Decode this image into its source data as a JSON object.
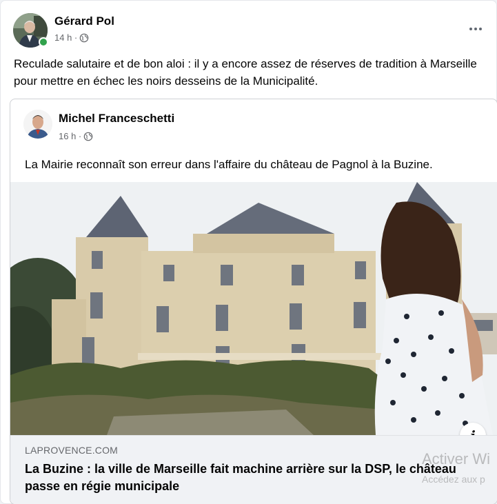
{
  "post": {
    "author_name": "Gérard Pol",
    "timestamp": "14 h ·",
    "text": "Reculade salutaire et de bon aloi : il y a encore assez de réserves de tradition à Marseille pour mettre en échec les noirs desseins de la Municipalité.",
    "more_icon": "more-options-icon",
    "audience_icon": "globe-icon"
  },
  "shared_post": {
    "author_name": "Michel Franceschetti",
    "timestamp": "16 h ·",
    "text": "La Mairie reconnaît son erreur dans l'affaire du château de Pagnol à la Buzine.",
    "audience_icon": "globe-icon"
  },
  "link_preview": {
    "domain": "LAPROVENCE.COM",
    "title": "La Buzine : la ville de Marseille fait machine arrière sur la DSP, le château passe en régie municipale",
    "info_label": "i"
  },
  "watermark": {
    "line1": "Activer Wi",
    "line2": "Accédez aux p"
  },
  "colors": {
    "online": "#31a24c",
    "secondary_text": "#65676b",
    "footer_bg": "#f0f2f5"
  }
}
